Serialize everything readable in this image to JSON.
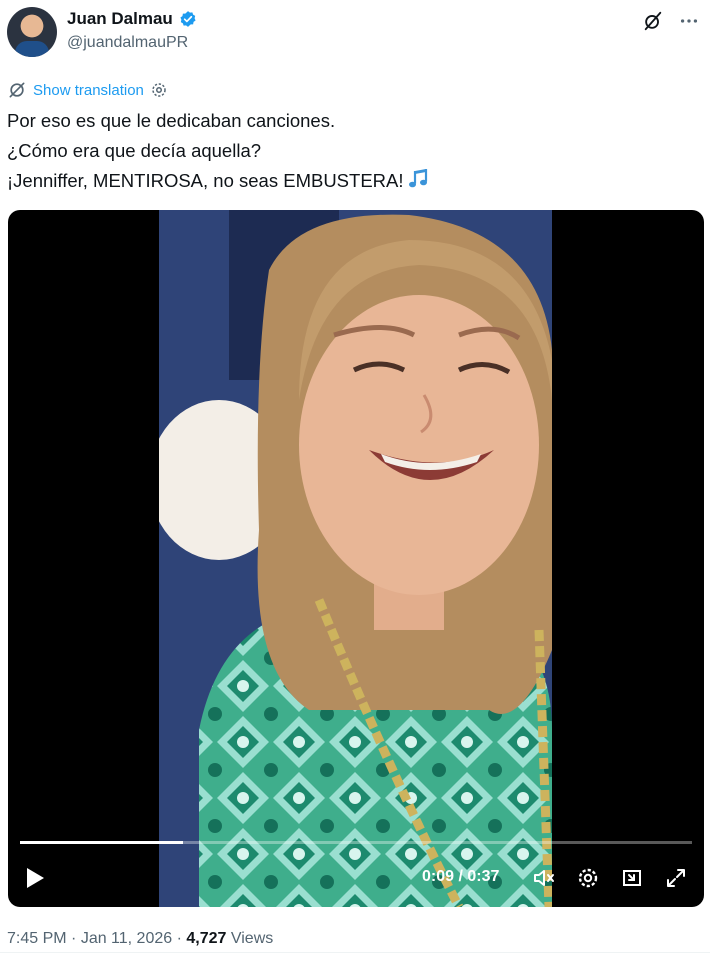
{
  "author": {
    "name": "Juan Dalmau",
    "handle": "@juandalmauPR",
    "verified": true,
    "verified_color": "#1d9bf0"
  },
  "header_icons": [
    "grok-icon",
    "more-icon"
  ],
  "translate": {
    "label": "Show translation",
    "color": "#1d9bf0"
  },
  "tweet": {
    "lines": [
      "Por eso es que le dedicaban canciones.",
      "¿Cómo era que decía aquella?",
      "¡Jenniffer, MENTIROSA, no seas EMBUSTERA!"
    ],
    "emoji": "music-notes-icon"
  },
  "video": {
    "time_current": "0:09",
    "time_separator": " / ",
    "time_total": "0:37",
    "progress": 0.243,
    "controls": [
      "play-icon",
      "volume-icon",
      "settings-icon",
      "pip-icon",
      "fullscreen-icon"
    ]
  },
  "meta": {
    "time": "7:45 PM",
    "separator": " · ",
    "date": "Jan 11, 2026",
    "views_count": "4,727",
    "views_label": " Views"
  }
}
